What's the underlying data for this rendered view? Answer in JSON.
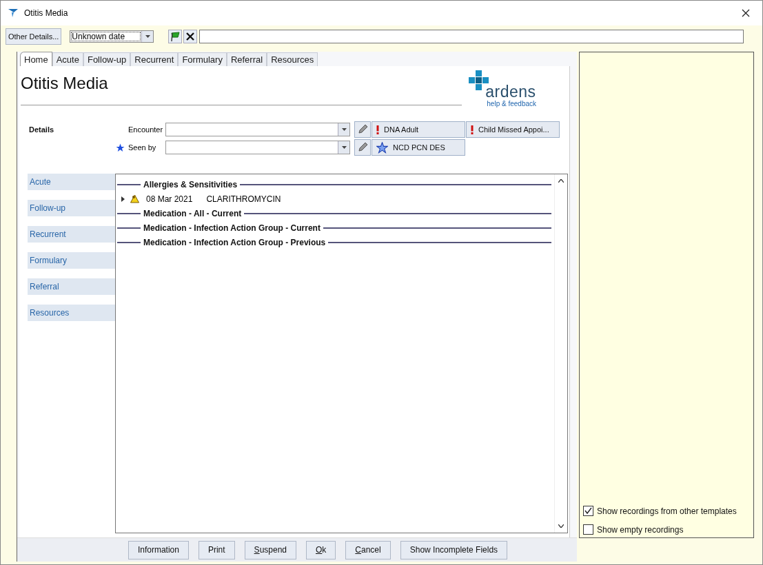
{
  "window": {
    "title": "Otitis Media"
  },
  "toolbar": {
    "other_details_button": "Other Details...",
    "date_combo": {
      "value": "Unknown date"
    }
  },
  "tabs": [
    {
      "label": "Home",
      "selected": true
    },
    {
      "label": "Acute",
      "selected": false
    },
    {
      "label": "Follow-up",
      "selected": false
    },
    {
      "label": "Recurrent",
      "selected": false
    },
    {
      "label": "Formulary",
      "selected": false
    },
    {
      "label": "Referral",
      "selected": false
    },
    {
      "label": "Resources",
      "selected": false
    }
  ],
  "page": {
    "title": "Otitis Media",
    "logo": {
      "name": "ardens",
      "subtitle": "help & feedback"
    }
  },
  "details": {
    "label": "Details",
    "fields": [
      {
        "label": "Encounter",
        "required": false,
        "buttons": [
          {
            "label": "DNA Adult",
            "kind": "alert"
          },
          {
            "label": "Child Missed Appoi...",
            "kind": "alert"
          }
        ]
      },
      {
        "label": "Seen by",
        "required": true,
        "buttons": [
          {
            "label": "NCD PCN DES",
            "kind": "star"
          }
        ]
      }
    ]
  },
  "nav": [
    "Acute",
    "Follow-up",
    "Recurrent",
    "Formulary",
    "Referral",
    "Resources"
  ],
  "list": [
    {
      "kind": "header",
      "title": "Allergies & Sensitivities"
    },
    {
      "kind": "entry",
      "date": "08 Mar 2021",
      "text": "CLARITHROMYCIN"
    },
    {
      "kind": "header",
      "title": "Medication - All - Current"
    },
    {
      "kind": "header",
      "title": "Medication - Infection Action Group - Current"
    },
    {
      "kind": "header",
      "title": "Medication - Infection Action Group - Previous"
    }
  ],
  "options": [
    {
      "label": "Show recordings from other templates",
      "checked": true
    },
    {
      "label": "Show empty recordings",
      "checked": false
    }
  ],
  "buttons": [
    {
      "label": "Information",
      "mnemonic": false
    },
    {
      "label": "Print",
      "mnemonic": false
    },
    {
      "label": "Suspend",
      "mnemonic": true
    },
    {
      "label": "Ok",
      "mnemonic": true
    },
    {
      "label": "Cancel",
      "mnemonic": true
    },
    {
      "label": "Show Incomplete Fields",
      "mnemonic": false
    }
  ]
}
